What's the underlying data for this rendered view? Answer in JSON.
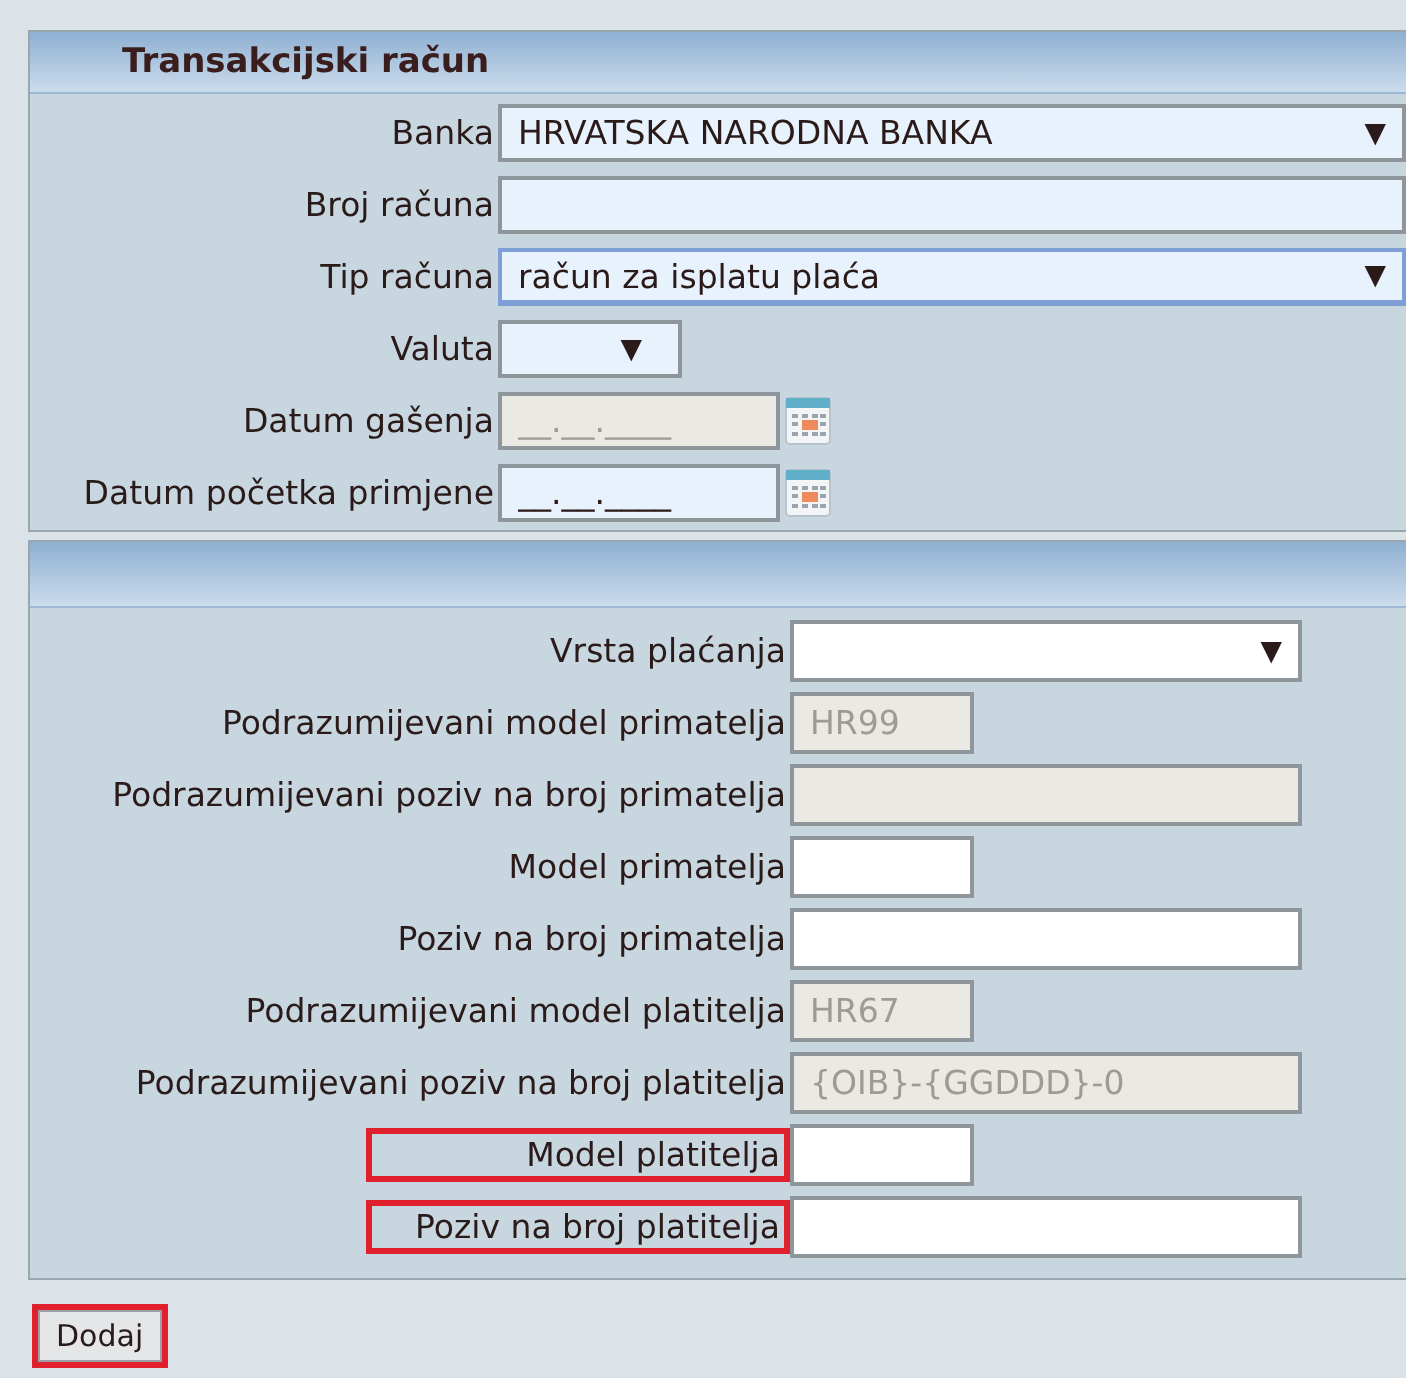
{
  "sections": [
    {
      "title": "Transakcijski račun",
      "fields": [
        {
          "label": "Banka",
          "kind": "select",
          "value": "HRVATSKA NARODNA BANKA",
          "disabled": false,
          "focused": false,
          "highlighted": false
        },
        {
          "label": "Broj računa",
          "kind": "field",
          "disabled": false,
          "focused": false,
          "highlighted": false
        },
        {
          "label": "Tip računa",
          "kind": "select",
          "value": "račun za isplatu plaća",
          "disabled": false,
          "focused": true,
          "highlighted": false
        },
        {
          "label": "Valuta",
          "kind": "combo",
          "disabled": false,
          "focused": false,
          "highlighted": false
        },
        {
          "label": "Datum gašenja",
          "kind": "date",
          "placeholder": "__.__.____",
          "disabled": true,
          "focused": false,
          "highlighted": false
        },
        {
          "label": "Datum početka primjene",
          "kind": "date",
          "placeholder": "__.__.____",
          "disabled": false,
          "focused": false,
          "highlighted": false
        }
      ]
    },
    {
      "fields": [
        {
          "label": "Vrsta plaćanja",
          "kind": "select",
          "disabled": false,
          "focused": false,
          "highlighted": false
        },
        {
          "label": "Podrazumijevani model primatelja",
          "kind": "code",
          "value": "HR99",
          "disabled": true,
          "focused": false,
          "highlighted": false
        },
        {
          "label": "Podrazumijevani poziv na broj primatelja",
          "kind": "field",
          "disabled": true,
          "focused": false,
          "highlighted": false
        },
        {
          "label": "Model primatelja",
          "kind": "code",
          "disabled": false,
          "focused": false,
          "highlighted": false
        },
        {
          "label": "Poziv na broj primatelja",
          "kind": "field",
          "disabled": false,
          "focused": false,
          "highlighted": false
        },
        {
          "label": "Podrazumijevani model platitelja",
          "kind": "code",
          "value": "HR67",
          "disabled": true,
          "focused": false,
          "highlighted": false
        },
        {
          "label": "Podrazumijevani poziv na broj platitelja",
          "kind": "field",
          "value": "{OIB}-{GGDDD}-0",
          "disabled": true,
          "focused": false,
          "highlighted": false
        },
        {
          "label": "Model platitelja",
          "kind": "code",
          "disabled": false,
          "focused": false,
          "highlighted": true
        },
        {
          "label": "Poziv na broj platitelja",
          "kind": "field",
          "disabled": false,
          "focused": false,
          "highlighted": true
        }
      ]
    }
  ],
  "button": {
    "label": "Dodaj",
    "highlighted": true
  },
  "dropdown_arrow": "▼"
}
